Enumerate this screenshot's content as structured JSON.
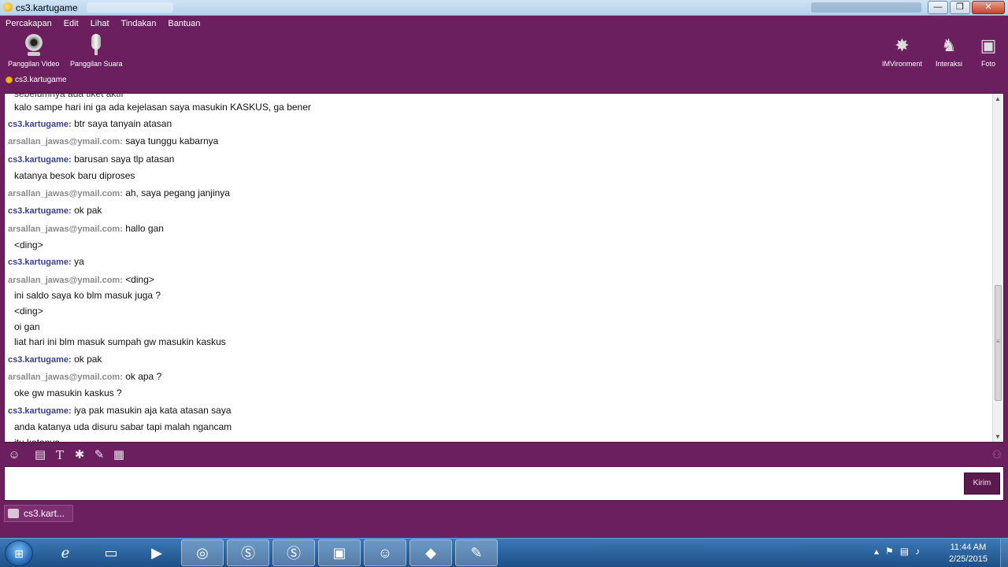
{
  "window": {
    "title": "cs3.kartugame",
    "controls": {
      "minimize": "—",
      "maximize": "❐",
      "close": "✕"
    }
  },
  "menu": [
    "Percakapan",
    "Edit",
    "Lihat",
    "Tindakan",
    "Bantuan"
  ],
  "toolbar": {
    "video_call": "Panggilan Video",
    "voice_call": "Panggilan Suara",
    "imvironment": "IMVironment",
    "interaksi": "Interaksi",
    "foto": "Foto"
  },
  "contact": {
    "name": "cs3.kartugame",
    "status_color": "#f6b800"
  },
  "messages": [
    {
      "type": "cont",
      "text": "kalo sampe hari ini ga ada kejelasan saya masukin KASKUS, ga bener"
    },
    {
      "type": "msg",
      "sender": "cs3.kartugame:",
      "who": "cs",
      "text": "btr saya tanyain atasan"
    },
    {
      "type": "msg",
      "sender": "arsallan_jawas@ymail.com:",
      "who": "ars",
      "text": "saya tunggu kabarnya"
    },
    {
      "type": "msg",
      "sender": "cs3.kartugame:",
      "who": "cs",
      "text": "barusan saya tlp atasan"
    },
    {
      "type": "cont",
      "text": "katanya besok baru diproses"
    },
    {
      "type": "msg",
      "sender": "arsallan_jawas@ymail.com:",
      "who": "ars",
      "text": "ah, saya pegang janjinya"
    },
    {
      "type": "msg",
      "sender": "cs3.kartugame:",
      "who": "cs",
      "text": "ok pak"
    },
    {
      "type": "msg",
      "sender": "arsallan_jawas@ymail.com:",
      "who": "ars",
      "text": "hallo gan"
    },
    {
      "type": "cont",
      "text": "<ding>"
    },
    {
      "type": "msg",
      "sender": "cs3.kartugame:",
      "who": "cs",
      "text": "ya"
    },
    {
      "type": "msg",
      "sender": "arsallan_jawas@ymail.com:",
      "who": "ars",
      "text": "<ding>"
    },
    {
      "type": "cont",
      "text": "ini saldo saya ko blm masuk juga ?"
    },
    {
      "type": "cont",
      "text": "<ding>"
    },
    {
      "type": "cont",
      "text": "oi gan"
    },
    {
      "type": "cont",
      "text": "liat hari ini blm masuk sumpah gw masukin kaskus"
    },
    {
      "type": "msg",
      "sender": "cs3.kartugame:",
      "who": "cs",
      "text": "ok pak"
    },
    {
      "type": "msg",
      "sender": "arsallan_jawas@ymail.com:",
      "who": "ars",
      "text": "ok apa ?"
    },
    {
      "type": "cont",
      "text": "oke gw masukin kaskus ?"
    },
    {
      "type": "msg",
      "sender": "cs3.kartugame:",
      "who": "cs",
      "text": "iya pak masukin aja kata atasan saya"
    },
    {
      "type": "cont",
      "text": "anda katanya uda disuru sabar tapi malah ngancam"
    },
    {
      "type": "cont",
      "text": "itu katanya"
    }
  ],
  "send_label": "Kirim",
  "conversation_tab": "cs3.kart...",
  "taskbar": {
    "start_icon": "windows-orb-icon",
    "apps": [
      "internet-explorer-icon",
      "file-explorer-icon",
      "media-player-icon",
      "app-swirl-icon",
      "skype-icon",
      "app-sa-icon",
      "monitor-app-icon",
      "yahoo-messenger-icon",
      "dota-icon",
      "paint-icon"
    ],
    "time": "11:44 AM",
    "date": "2/25/2015"
  }
}
